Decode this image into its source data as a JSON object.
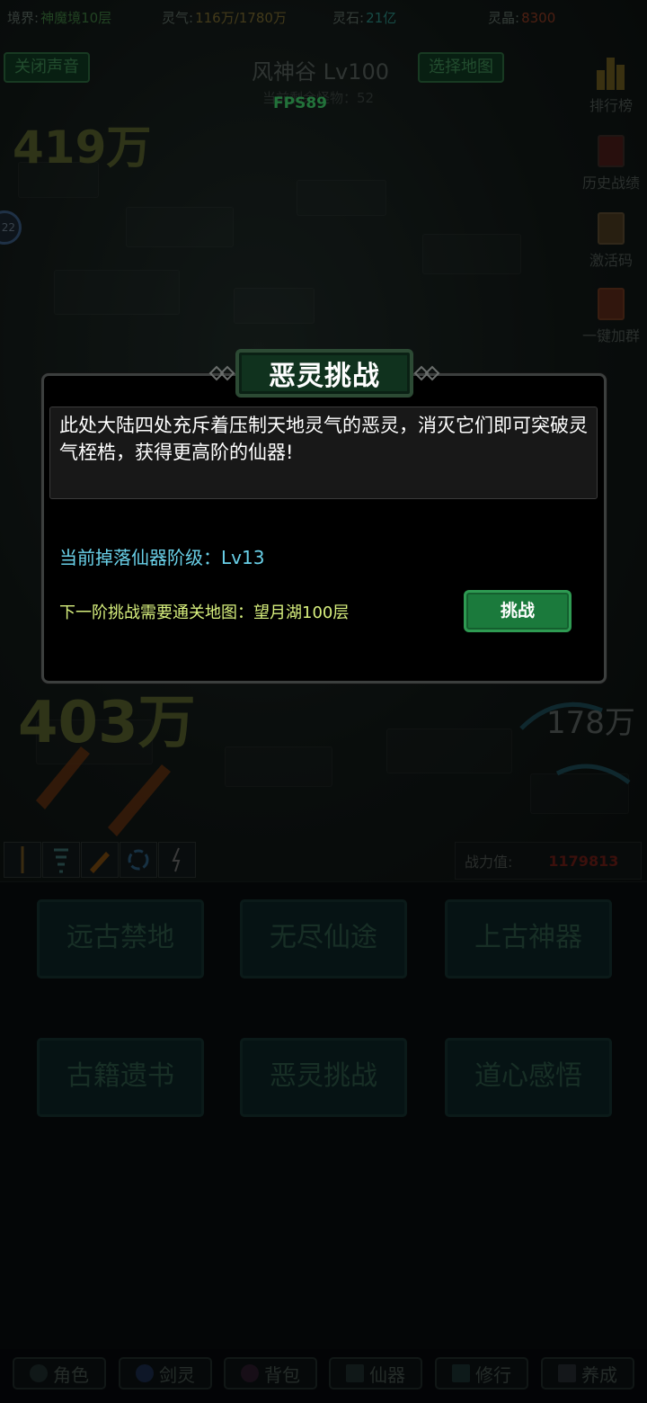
{
  "resources": {
    "realm_label": "境界:",
    "realm_value": "神魔境10层",
    "qi_label": "灵气:",
    "qi_value": "116万/1780万",
    "stone_label": "灵石:",
    "stone_value": "21亿",
    "crystal_label": "灵晶:",
    "crystal_value": "8300",
    "colors": {
      "realm": "#3d7a3f",
      "qi": "#7a6a30",
      "stone": "#2a8a80",
      "crystal": "#8a3a22"
    }
  },
  "top_controls": {
    "sound_toggle": "关闭声音",
    "map_title": "风神谷 Lv100",
    "monster_remain": "当前剩余怪物：52",
    "select_map": "选择地图",
    "fps": "FPS89"
  },
  "side_menu": [
    {
      "label": "排行榜",
      "icon": "ranking-icon"
    },
    {
      "label": "历史战绩",
      "icon": "history-icon"
    },
    {
      "label": "激活码",
      "icon": "code-icon"
    },
    {
      "label": "一键加群",
      "icon": "group-icon"
    }
  ],
  "damage_numbers": {
    "d1": "419万",
    "d2": "403万",
    "d3": "178万",
    "d4": "22"
  },
  "skills": [
    "sword-skill-icon",
    "tornado-skill-icon",
    "fireball-skill-icon",
    "vortex-skill-icon",
    "lightning-skill-icon"
  ],
  "power": {
    "label": "战力值:",
    "value": "1179813"
  },
  "menu_buttons": [
    "远古禁地",
    "无尽仙途",
    "上古神器",
    "古籍遗书",
    "恶灵挑战",
    "道心感悟"
  ],
  "bottom_nav": [
    {
      "label": "角色",
      "icon": "character-icon"
    },
    {
      "label": "剑灵",
      "icon": "sword-spirit-icon"
    },
    {
      "label": "背包",
      "icon": "bag-icon"
    },
    {
      "label": "仙器",
      "icon": "artifact-icon"
    },
    {
      "label": "修行",
      "icon": "cultivation-icon"
    },
    {
      "label": "养成",
      "icon": "nurture-icon"
    }
  ],
  "modal": {
    "title": "恶灵挑战",
    "description": "此处大陆四处充斥着压制天地灵气的恶灵，消灭它们即可突破灵气桎梏，获得更高阶的仙器!",
    "drop_level": "当前掉落仙器阶级：Lv13",
    "next_requirement": "下一阶挑战需要通关地图：望月湖100层",
    "challenge_button": "挑战"
  }
}
